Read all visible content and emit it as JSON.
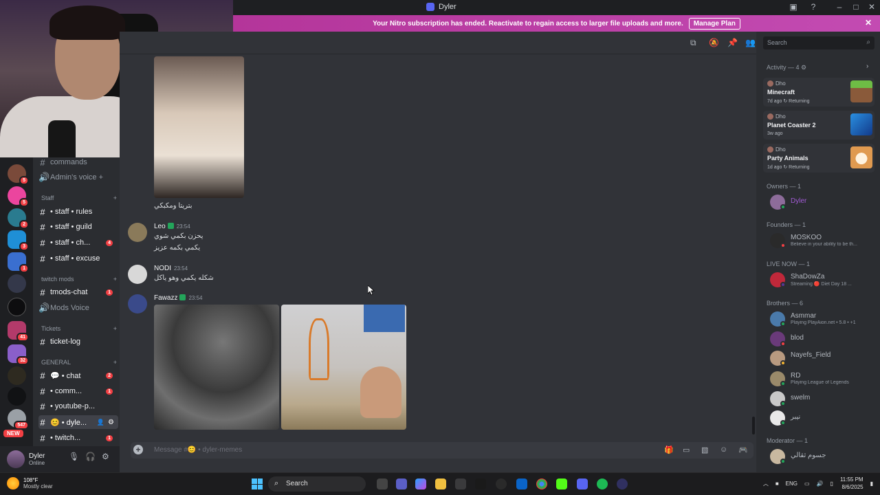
{
  "window": {
    "title": "Dyler"
  },
  "banner": {
    "text": "Your Nitro subscription has ended. Reactivate to regain access to larger file uploads and more.",
    "button": "Manage Plan"
  },
  "servers": {
    "badges": [
      "6",
      "5",
      "5",
      "2",
      "3",
      "1",
      "",
      "41",
      "32",
      "",
      "",
      "547"
    ],
    "new_label": "NEW"
  },
  "channels": [
    {
      "type": "text",
      "name": "commands"
    },
    {
      "type": "voice",
      "name": "Admin's voice +"
    },
    {
      "type": "category",
      "name": "Staff"
    },
    {
      "type": "text",
      "name": "• staff • rules"
    },
    {
      "type": "text",
      "name": "• staff • guild"
    },
    {
      "type": "text",
      "name": "• staff • ch...",
      "count": "4"
    },
    {
      "type": "text",
      "name": "• staff • excuse"
    },
    {
      "type": "category",
      "name": "twitch mods"
    },
    {
      "type": "text",
      "name": "tmods-chat",
      "count": "1"
    },
    {
      "type": "voice",
      "name": "Mods Voice"
    },
    {
      "type": "category",
      "name": "Tickets"
    },
    {
      "type": "text",
      "name": "ticket-log"
    },
    {
      "type": "category",
      "name": "GENERAL"
    },
    {
      "type": "text",
      "name": "💬 • chat",
      "count": "2"
    },
    {
      "type": "text",
      "name": "• comm...",
      "count": "1"
    },
    {
      "type": "text",
      "name": "• youtube-p..."
    },
    {
      "type": "text",
      "name": "😊 • dyle...",
      "active": true
    },
    {
      "type": "text",
      "name": "• twitch...",
      "count": "1"
    }
  ],
  "user": {
    "name": "Dyler",
    "status": "Online"
  },
  "chat": {
    "first_caption": "بتريتا ومكبكي",
    "messages": [
      {
        "author": "Leo",
        "time": "23:54",
        "lines": [
          "يحزن بكمي شوي",
          "يكمي بكمه عزيز"
        ]
      },
      {
        "author": "NODI",
        "time": "23:54",
        "lines": [
          "شكله يكمي وهو ياكل"
        ]
      },
      {
        "author": "Fawazz",
        "time": "23:54",
        "lines": []
      }
    ],
    "composer_placeholder": "Message #😊 • dyler-memes"
  },
  "header": {
    "search_placeholder": "Search"
  },
  "members": {
    "activity_label": "Activity — 4",
    "activities": [
      {
        "user": "Dho",
        "game": "Minecraft",
        "meta": "7d ago  ↻ Returning",
        "color": "#5d9b3a"
      },
      {
        "user": "Dho",
        "game": "Planet Coaster 2",
        "meta": "3w ago",
        "color": "#1f6fc9"
      },
      {
        "user": "Dho",
        "game": "Party Animals",
        "meta": "1d ago  ↻ Returning",
        "color": "#e0a060"
      }
    ],
    "groups": [
      {
        "label": "Owners — 1",
        "members": [
          {
            "name": "Dyler",
            "status": "",
            "color": "#a35bd6"
          }
        ]
      },
      {
        "label": "Founders — 1",
        "members": [
          {
            "name": "MOSKOO",
            "status": "Believe in your ability to be th..."
          }
        ]
      },
      {
        "label": "LIVE NOW — 1",
        "members": [
          {
            "name": "ShaDowZa",
            "status": "Streaming  🔴 Diet Day 18 ..."
          }
        ]
      },
      {
        "label": "Brothers — 6",
        "members": [
          {
            "name": "Asmmar",
            "status": "Playing PlayAion.net • 5.8 • +1"
          },
          {
            "name": "blod",
            "status": ""
          },
          {
            "name": "Nayefs_Field",
            "status": ""
          },
          {
            "name": "RD",
            "status": "Playing League of Legends"
          },
          {
            "name": "swelm",
            "status": ""
          },
          {
            "name": "نيبر",
            "status": ""
          }
        ]
      },
      {
        "label": "Moderator — 1",
        "members": [
          {
            "name": "جسوم ثقالي",
            "status": ""
          }
        ]
      }
    ]
  },
  "taskbar": {
    "weather_temp": "108°F",
    "weather_desc": "Mostly clear",
    "search": "Search",
    "lang": "ENG",
    "time": "11:55 PM",
    "date": "8/6/2025"
  }
}
